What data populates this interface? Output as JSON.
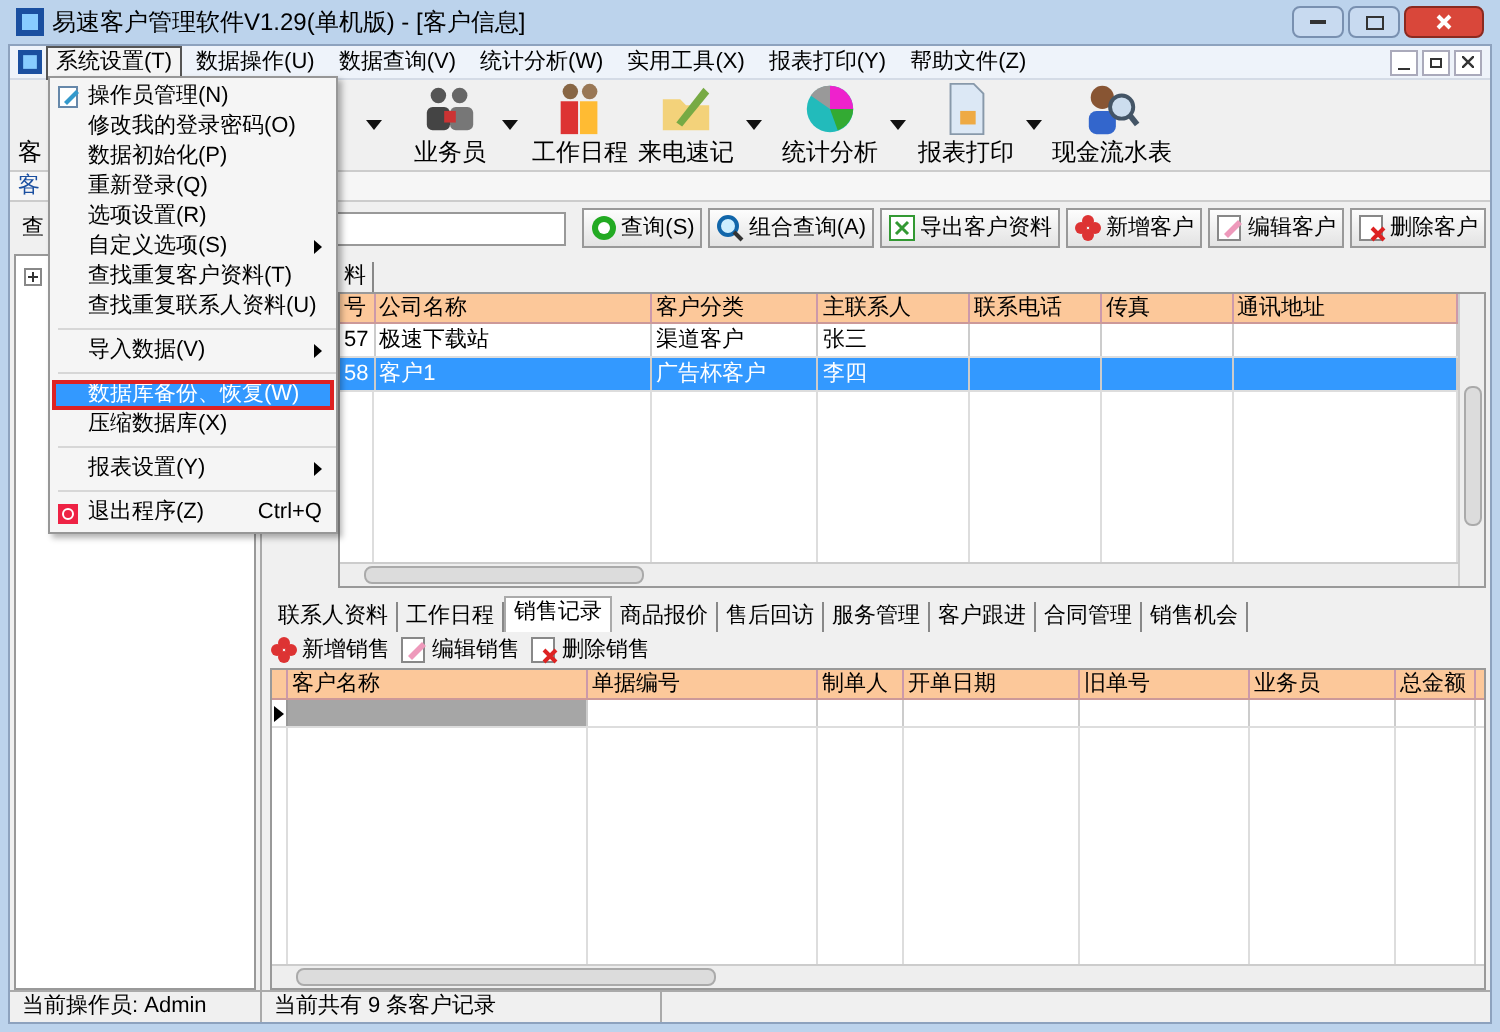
{
  "window": {
    "title": "易速客户管理软件V1.29(单机版) - [客户信息]"
  },
  "menubar": [
    {
      "label": "系统设置(T)",
      "selected": true
    },
    {
      "label": "数据操作(U)",
      "selected": false
    },
    {
      "label": "数据查询(V)",
      "selected": false
    },
    {
      "label": "统计分析(W)",
      "selected": false
    },
    {
      "label": "实用工具(X)",
      "selected": false
    },
    {
      "label": "报表打印(Y)",
      "selected": false
    },
    {
      "label": "帮助文件(Z)",
      "selected": false
    }
  ],
  "toolbar": [
    {
      "label": "客",
      "dropdown": false
    },
    {
      "dropdown": true
    },
    {
      "label": "业务员",
      "dropdown": true
    },
    {
      "label": "工作日程",
      "dropdown": false
    },
    {
      "label": "来电速记",
      "dropdown": true
    },
    {
      "label": "统计分析",
      "dropdown": true
    },
    {
      "label": "报表打印",
      "dropdown": true
    },
    {
      "label": "现金流水表",
      "dropdown": false
    }
  ],
  "doc_tab": "客",
  "left_panel": {
    "button": "查",
    "tree_expanded": false
  },
  "actions": [
    "查询(S)",
    "组合查询(A)",
    "导出客户资料",
    "新增客户",
    "编辑客户",
    "删除客户"
  ],
  "grid_tab": "料",
  "table": {
    "columns": [
      "号",
      "公司名称",
      "客户分类",
      "主联系人",
      "联系电话",
      "传真",
      "通讯地址"
    ],
    "rows": [
      {
        "cells": [
          "57",
          "极速下载站",
          "渠道客户",
          "张三",
          "",
          "",
          ""
        ],
        "selected": false
      },
      {
        "cells": [
          "58",
          "客户1",
          "广告杯客户",
          "李四",
          "",
          "",
          ""
        ],
        "selected": true
      }
    ]
  },
  "detail_tabs": [
    {
      "label": "联系人资料",
      "selected": false
    },
    {
      "label": "工作日程",
      "selected": false
    },
    {
      "label": "销售记录",
      "selected": true
    },
    {
      "label": "商品报价",
      "selected": false
    },
    {
      "label": "售后回访",
      "selected": false
    },
    {
      "label": "服务管理",
      "selected": false
    },
    {
      "label": "客户跟进",
      "selected": false
    },
    {
      "label": "合同管理",
      "selected": false
    },
    {
      "label": "销售机会",
      "selected": false
    }
  ],
  "detail_actions": [
    "新增销售",
    "编辑销售",
    "删除销售"
  ],
  "detail_table": {
    "columns": [
      "客户名称",
      "单据编号",
      "制单人",
      "开单日期",
      "旧单号",
      "业务员",
      "总金额"
    ]
  },
  "status_bar": [
    "当前操作员: Admin",
    "当前共有 9 条客户记录"
  ],
  "menu": [
    {
      "kind": "item",
      "label": "操作员管理(N)",
      "submenu": false,
      "selected": false
    },
    {
      "kind": "item",
      "label": "修改我的登录密码(O)",
      "submenu": false,
      "selected": false
    },
    {
      "kind": "item",
      "label": "数据初始化(P)",
      "submenu": false,
      "selected": false
    },
    {
      "kind": "item",
      "label": "重新登录(Q)",
      "submenu": false,
      "selected": false
    },
    {
      "kind": "item",
      "label": "选项设置(R)",
      "submenu": false,
      "selected": false
    },
    {
      "kind": "item",
      "label": "自定义选项(S)",
      "submenu": true,
      "selected": false
    },
    {
      "kind": "item",
      "label": "查找重复客户资料(T)",
      "submenu": false,
      "selected": false
    },
    {
      "kind": "item",
      "label": "查找重复联系人资料(U)",
      "submenu": false,
      "selected": false
    },
    {
      "kind": "separator"
    },
    {
      "kind": "item",
      "label": "导入数据(V)",
      "submenu": true,
      "selected": false
    },
    {
      "kind": "separator"
    },
    {
      "kind": "item",
      "label": "数据库备份、恢复(W)",
      "submenu": false,
      "selected": true
    },
    {
      "kind": "item",
      "label": "压缩数据库(X)",
      "submenu": false,
      "selected": false
    },
    {
      "kind": "separator"
    },
    {
      "kind": "item",
      "label": "报表设置(Y)",
      "submenu": true,
      "selected": false
    },
    {
      "kind": "separator"
    },
    {
      "kind": "item",
      "label": "退出程序(Z)",
      "shortcut": "Ctrl+Q",
      "submenu": false,
      "selected": false
    }
  ]
}
